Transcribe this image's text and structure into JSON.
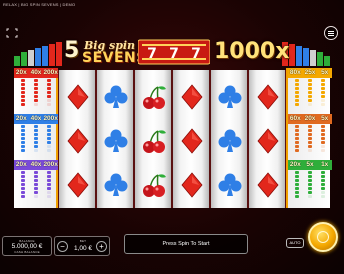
{
  "window": {
    "title": "RELAX | BIG SPIN SEVENS | DEMO"
  },
  "logo": {
    "five": "5",
    "big_spin": "Big spin",
    "sevens": "SEVENS",
    "multiplier": "1000x",
    "sevens_glyph": "7"
  },
  "left_paytable": [
    {
      "head": [
        "20x",
        "40x",
        "200x"
      ]
    },
    {
      "head": [
        "20x",
        "40x",
        "200x"
      ]
    },
    {
      "head": [
        "20x",
        "40x",
        "200x"
      ]
    }
  ],
  "right_paytable": [
    {
      "head": [
        "80x",
        "25x",
        "5x"
      ]
    },
    {
      "head": [
        "60x",
        "20x",
        "5x"
      ]
    },
    {
      "head": [
        "20x",
        "5x",
        "1x"
      ]
    }
  ],
  "reels": [
    [
      "diamond",
      "diamond",
      "diamond"
    ],
    [
      "club",
      "club",
      "club"
    ],
    [
      "cherry",
      "cherry",
      "cherry"
    ],
    [
      "diamond",
      "diamond",
      "diamond"
    ],
    [
      "club",
      "club",
      "club"
    ],
    [
      "diamond",
      "diamond",
      "diamond"
    ]
  ],
  "balance": {
    "label": "BALANCE",
    "value": "5.000,00 €",
    "sub": "CASH BALANCE"
  },
  "bet": {
    "label": "BET",
    "value": "1,00 €",
    "minus": "−",
    "plus": "+"
  },
  "message": "Press Spin To Start",
  "auto_label": "AUTO",
  "colors": {
    "red": "#e2271c",
    "blue": "#2f7fe6",
    "gold": "#f4a800",
    "green": "#2fae3a"
  }
}
